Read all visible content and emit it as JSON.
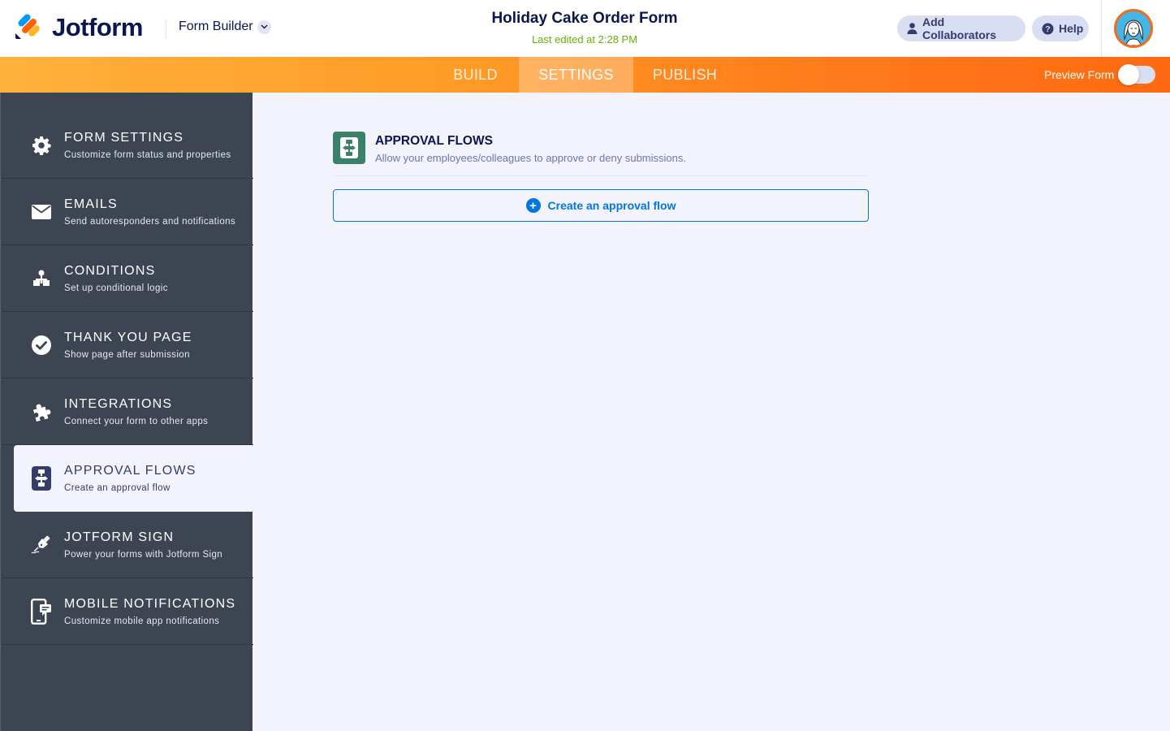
{
  "app": {
    "brand": "Jotform",
    "mode_label": "Form Builder"
  },
  "header": {
    "form_title": "Holiday Cake Order Form",
    "last_edited": "Last edited at 2:28 PM",
    "add_collaborators_label": "Add Collaborators",
    "help_label": "Help"
  },
  "nav": {
    "tabs": [
      {
        "label": "BUILD",
        "active": false
      },
      {
        "label": "SETTINGS",
        "active": true
      },
      {
        "label": "PUBLISH",
        "active": false
      }
    ],
    "preview_label": "Preview Form",
    "preview_enabled": false
  },
  "sidebar": {
    "items": [
      {
        "title": "FORM SETTINGS",
        "subtitle": "Customize form status and properties",
        "icon": "gear-icon"
      },
      {
        "title": "EMAILS",
        "subtitle": "Send autoresponders and notifications",
        "icon": "envelope-icon"
      },
      {
        "title": "CONDITIONS",
        "subtitle": "Set up conditional logic",
        "icon": "sitemap-icon"
      },
      {
        "title": "THANK YOU PAGE",
        "subtitle": "Show page after submission",
        "icon": "check-circle-icon"
      },
      {
        "title": "INTEGRATIONS",
        "subtitle": "Connect your form to other apps",
        "icon": "puzzle-icon"
      },
      {
        "title": "APPROVAL FLOWS",
        "subtitle": "Create an approval flow",
        "icon": "approval-flow-icon",
        "active": true
      },
      {
        "title": "JOTFORM SIGN",
        "subtitle": "Power your forms with Jotform Sign",
        "icon": "pen-sign-icon"
      },
      {
        "title": "MOBILE NOTIFICATIONS",
        "subtitle": "Customize mobile app notifications",
        "icon": "mobile-notification-icon"
      }
    ]
  },
  "main": {
    "section_title": "APPROVAL FLOWS",
    "section_description": "Allow your employees/colleagues to approve or deny submissions.",
    "create_button_label": "Create an approval flow"
  },
  "colors": {
    "brand_navy": "#0a1551",
    "accent_orange": "#ff6100",
    "sidebar_bg": "#3e4552",
    "approval_green": "#3b8069",
    "link_blue": "#0075e3",
    "edited_green": "#64b200"
  }
}
